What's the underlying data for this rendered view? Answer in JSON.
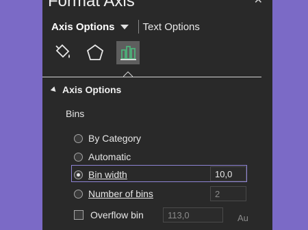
{
  "title": "Format Axis",
  "tabs": {
    "axis_options": "Axis Options",
    "text_options": "Text Options"
  },
  "section": {
    "header": "Axis Options",
    "bins_label": "Bins"
  },
  "options": {
    "by_category": "By Category",
    "automatic": "Automatic",
    "bin_width": "Bin width",
    "number_of_bins": "Number of bins",
    "overflow_bin": "Overflow bin"
  },
  "values": {
    "bin_width": "10,0",
    "number_of_bins": "2",
    "overflow_bin": "113,0",
    "auto_label": "Au"
  },
  "selected_option": "bin_width",
  "colors": {
    "background": "#7b6ac6",
    "panel": "#292929",
    "accent": "#8f84d6",
    "chart_icon": "#4db37a"
  }
}
